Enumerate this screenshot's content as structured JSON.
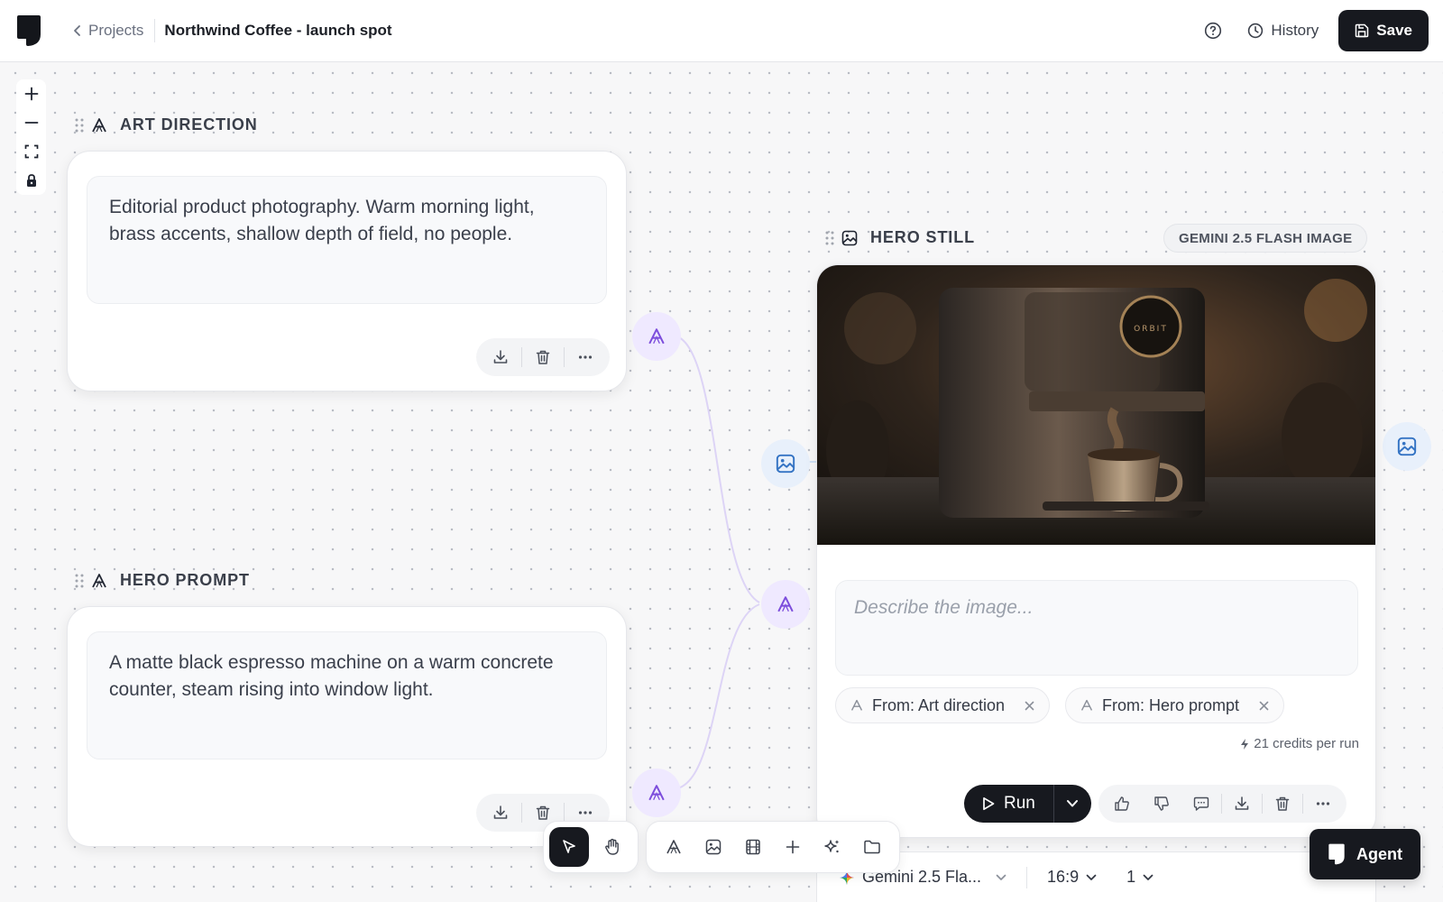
{
  "header": {
    "back_label": "Projects",
    "project_title": "Northwind Coffee - launch spot",
    "history_label": "History",
    "save_label": "Save"
  },
  "nodes": {
    "art_direction": {
      "title": "ART DIRECTION",
      "text": "Editorial product photography. Warm morning light, brass accents, shallow depth of field, no people."
    },
    "hero_prompt": {
      "title": "HERO PROMPT",
      "text": "A matte black espresso machine on a warm concrete counter, steam rising into window light."
    },
    "hero_still": {
      "title": "HERO STILL",
      "model_badge": "GEMINI 2.5 FLASH IMAGE",
      "image_brand_mark": "ORBIT",
      "prompt_placeholder": "Describe the image...",
      "chips": [
        "From: Art direction",
        "From: Hero prompt"
      ],
      "credits": "21 credits per run",
      "run_label": "Run"
    }
  },
  "settings": {
    "model": "Gemini 2.5 Fla...",
    "aspect_ratio": "16:9",
    "count": "1"
  },
  "agent_label": "Agent",
  "colors": {
    "text_port": "#7c4ddc",
    "image_port": "#3574c4",
    "primary_dark": "#17191f"
  }
}
